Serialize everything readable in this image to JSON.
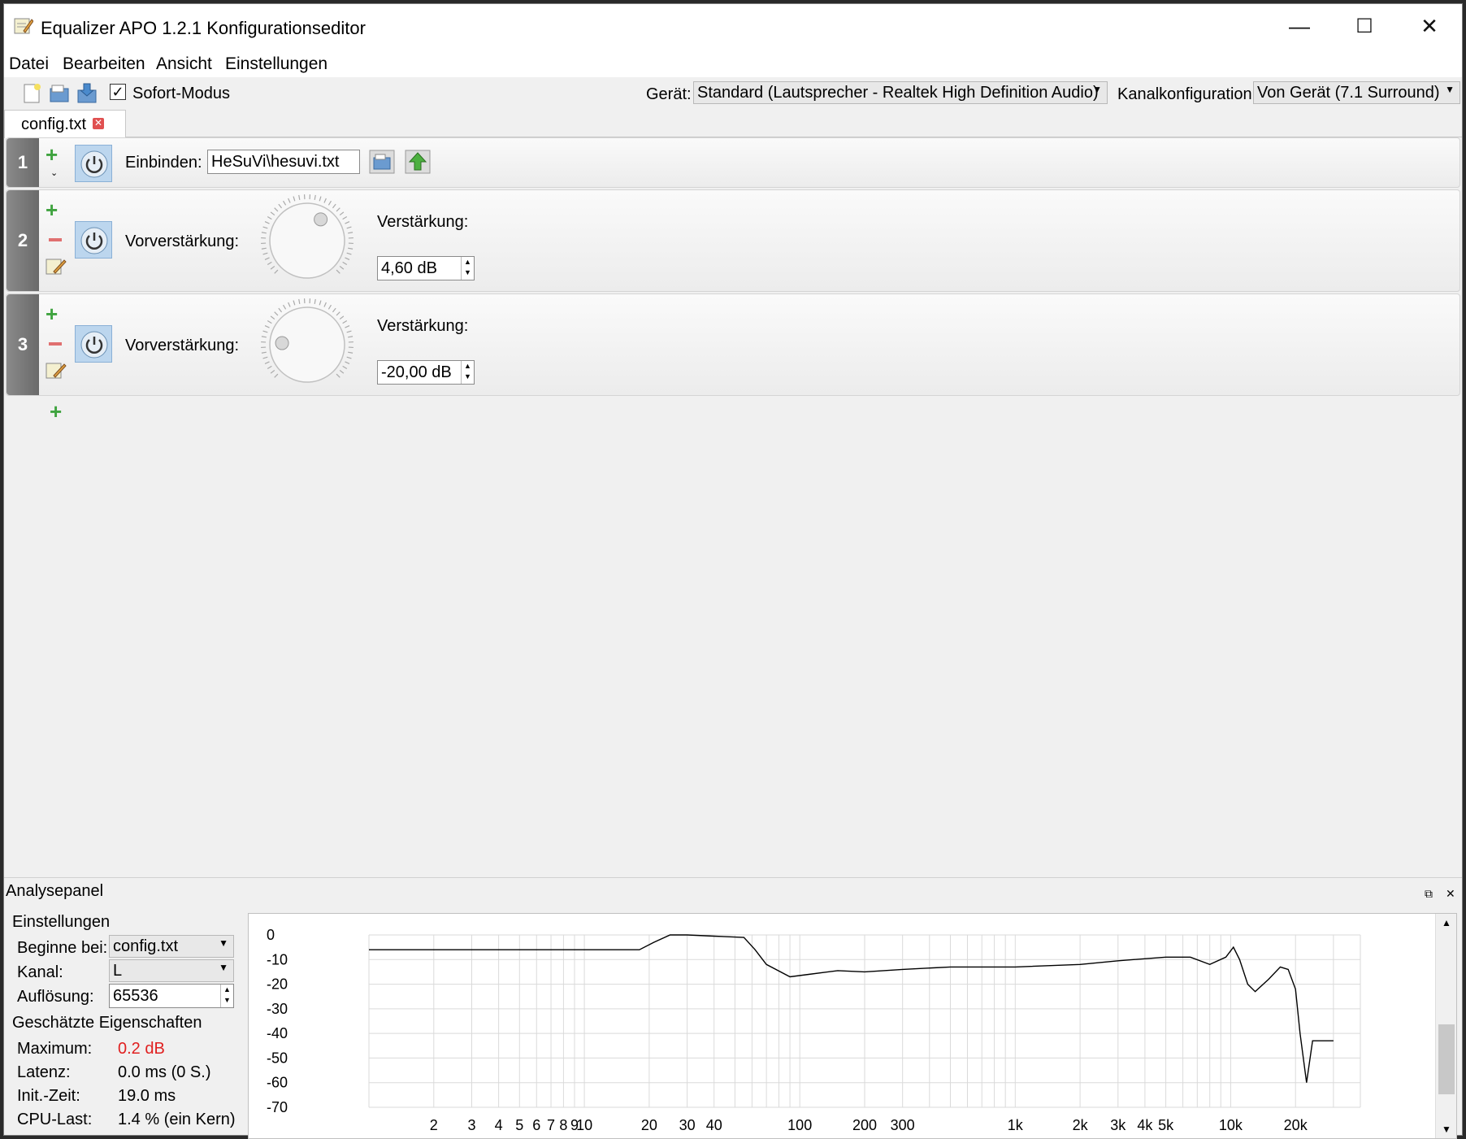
{
  "window": {
    "title": "Equalizer APO 1.2.1 Konfigurationseditor",
    "minimize": "—",
    "maximize": "☐",
    "close": "✕"
  },
  "menu": [
    "Datei",
    "Bearbeiten",
    "Ansicht",
    "Einstellungen"
  ],
  "toolbar": {
    "instant_mode_label": "Sofort-Modus",
    "instant_mode_checked": true,
    "device_label": "Gerät:",
    "device_value": "Standard (Lautsprecher - Realtek High Definition Audio)",
    "channel_config_label": "Kanalkonfiguration:",
    "channel_config_value": "Von Gerät (7.1 Surround)"
  },
  "tab": {
    "label": "config.txt"
  },
  "rows": [
    {
      "number": "1",
      "label": "Einbinden:",
      "value": "HeSuVi\\hesuvi.txt"
    },
    {
      "number": "2",
      "label": "Vorverstärkung:",
      "gain_label": "Verstärkung:",
      "gain_value": "4,60 dB",
      "knob_fraction": 0.62
    },
    {
      "number": "3",
      "label": "Vorverstärkung:",
      "gain_label": "Verstärkung:",
      "gain_value": "-20,00 dB",
      "knob_fraction": 0.18
    }
  ],
  "analysis": {
    "title": "Analysepanel",
    "settings_title": "Einstellungen",
    "start_label": "Beginne bei:",
    "start_value": "config.txt",
    "channel_label": "Kanal:",
    "channel_value": "L",
    "resolution_label": "Auflösung:",
    "resolution_value": "65536",
    "estimated_title": "Geschätzte Eigenschaften",
    "max_label": "Maximum:",
    "max_value": "0.2 dB",
    "max_color": "#e02020",
    "latency_label": "Latenz:",
    "latency_value": "0.0 ms (0 S.)",
    "init_label": "Init.-Zeit:",
    "init_value": "19.0 ms",
    "cpu_label": "CPU-Last:",
    "cpu_value": "1.4 % (ein Kern)"
  },
  "chart_data": {
    "type": "line",
    "xscale": "log",
    "xlim": [
      1,
      40000
    ],
    "ylim": [
      -70,
      0
    ],
    "yticks": [
      0,
      -10,
      -20,
      -30,
      -40,
      -50,
      -60,
      -70
    ],
    "xtick_labels": [
      {
        "v": 2,
        "t": "2"
      },
      {
        "v": 3,
        "t": "3"
      },
      {
        "v": 4,
        "t": "4"
      },
      {
        "v": 5,
        "t": "5"
      },
      {
        "v": 6,
        "t": "6"
      },
      {
        "v": 7,
        "t": "7"
      },
      {
        "v": 8,
        "t": "8"
      },
      {
        "v": 9,
        "t": "9"
      },
      {
        "v": 10,
        "t": "10"
      },
      {
        "v": 20,
        "t": "20"
      },
      {
        "v": 30,
        "t": "30"
      },
      {
        "v": 40,
        "t": "40"
      },
      {
        "v": 100,
        "t": "100"
      },
      {
        "v": 200,
        "t": "200"
      },
      {
        "v": 300,
        "t": "300"
      },
      {
        "v": 1000,
        "t": "1k"
      },
      {
        "v": 2000,
        "t": "2k"
      },
      {
        "v": 3000,
        "t": "3k"
      },
      {
        "v": 4000,
        "t": "4k"
      },
      {
        "v": 5000,
        "t": "5k"
      },
      {
        "v": 10000,
        "t": "10k"
      },
      {
        "v": 20000,
        "t": "20k"
      }
    ],
    "series": [
      {
        "x": [
          1,
          10,
          18,
          21,
          25,
          30,
          40,
          55,
          62,
          70,
          90,
          110,
          150,
          200,
          300,
          500,
          1000,
          2000,
          3000,
          5000,
          6500,
          8000,
          9500,
          10300,
          11000,
          12000,
          13000,
          15000,
          17000,
          18500,
          20000,
          21000,
          22500,
          24000,
          26000,
          30000
        ],
        "y": [
          -6,
          -6,
          -6,
          -3,
          0,
          0,
          -0.5,
          -1,
          -6,
          -12,
          -17,
          -16,
          -14.5,
          -15,
          -14,
          -13,
          -13,
          -12,
          -10.5,
          -9,
          -9,
          -12,
          -9,
          -5,
          -10,
          -20,
          -23,
          -18,
          -13,
          -14,
          -22,
          -40,
          -60,
          -43,
          -43,
          -43
        ]
      }
    ]
  }
}
